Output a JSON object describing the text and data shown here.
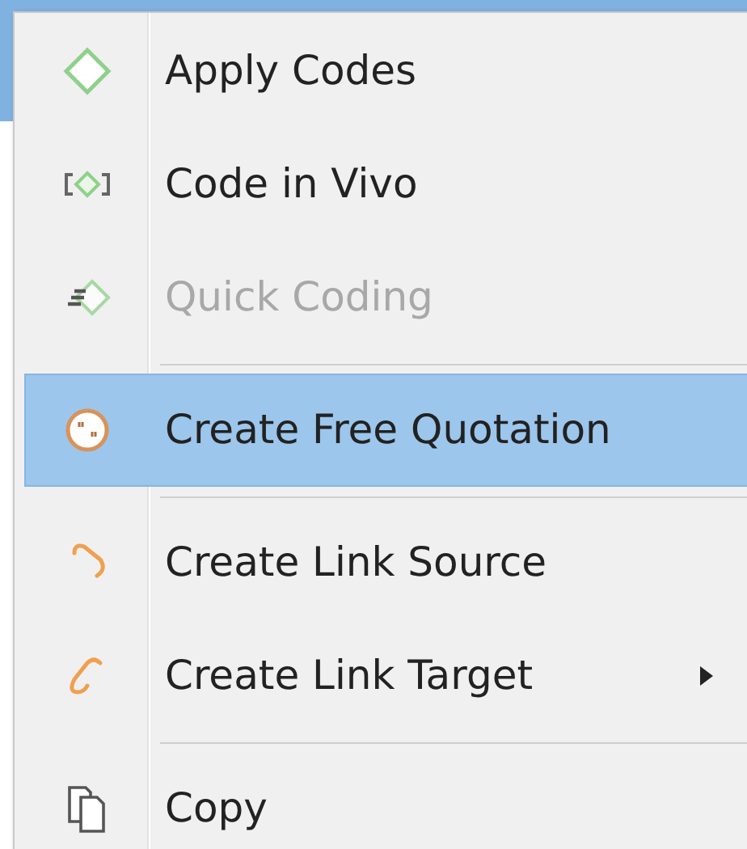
{
  "menu": {
    "items": [
      {
        "kind": "item",
        "label": "Apply Codes",
        "disabled": false,
        "selected": false,
        "submenu": false
      },
      {
        "kind": "item",
        "label": "Code in Vivo",
        "disabled": false,
        "selected": false,
        "submenu": false
      },
      {
        "kind": "item",
        "label": "Quick Coding",
        "disabled": true,
        "selected": false,
        "submenu": false
      },
      {
        "kind": "separator"
      },
      {
        "kind": "item",
        "label": "Create Free Quotation",
        "disabled": false,
        "selected": true,
        "submenu": false
      },
      {
        "kind": "separator"
      },
      {
        "kind": "item",
        "label": "Create Link Source",
        "disabled": false,
        "selected": false,
        "submenu": false
      },
      {
        "kind": "item",
        "label": "Create Link Target",
        "disabled": false,
        "selected": false,
        "submenu": true
      },
      {
        "kind": "separator"
      },
      {
        "kind": "item",
        "label": "Copy",
        "disabled": false,
        "selected": false,
        "submenu": false
      }
    ]
  }
}
